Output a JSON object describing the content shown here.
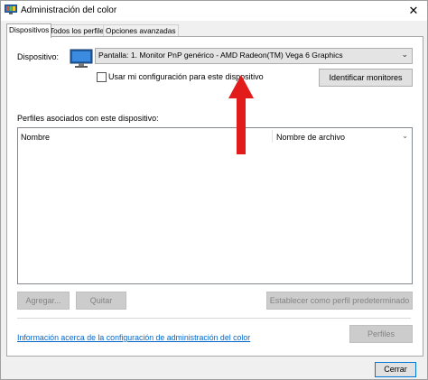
{
  "window": {
    "title": "Administración del color",
    "close_glyph": "✕"
  },
  "tabs": [
    {
      "label": "Dispositivos",
      "active": true
    },
    {
      "label": "Todos los perfiles",
      "active": false
    },
    {
      "label": "Opciones avanzadas",
      "active": false
    }
  ],
  "device": {
    "label": "Dispositivo:",
    "selected": "Pantalla: 1. Monitor PnP genérico - AMD Radeon(TM) Vega 6 Graphics",
    "checkbox_label": "Usar mi configuración para este dispositivo",
    "checkbox_checked": false,
    "identify_button": "Identificar monitores"
  },
  "profiles": {
    "label": "Perfiles asociados con este dispositivo:",
    "columns": [
      "Nombre",
      "Nombre de archivo"
    ],
    "rows": []
  },
  "actions": {
    "add": "Agregar...",
    "remove": "Quitar",
    "set_default": "Establecer como perfil predeterminado",
    "profiles": "Perfiles"
  },
  "footer": {
    "link": "Información acerca de la configuración de administración del color",
    "close": "Cerrar"
  },
  "icons": {
    "app": "color-management-icon",
    "device": "monitor-icon",
    "annotation": "red-arrow"
  },
  "colors": {
    "accent": "#0078d7",
    "link": "#0066cc",
    "arrow": "#e21b1b"
  }
}
